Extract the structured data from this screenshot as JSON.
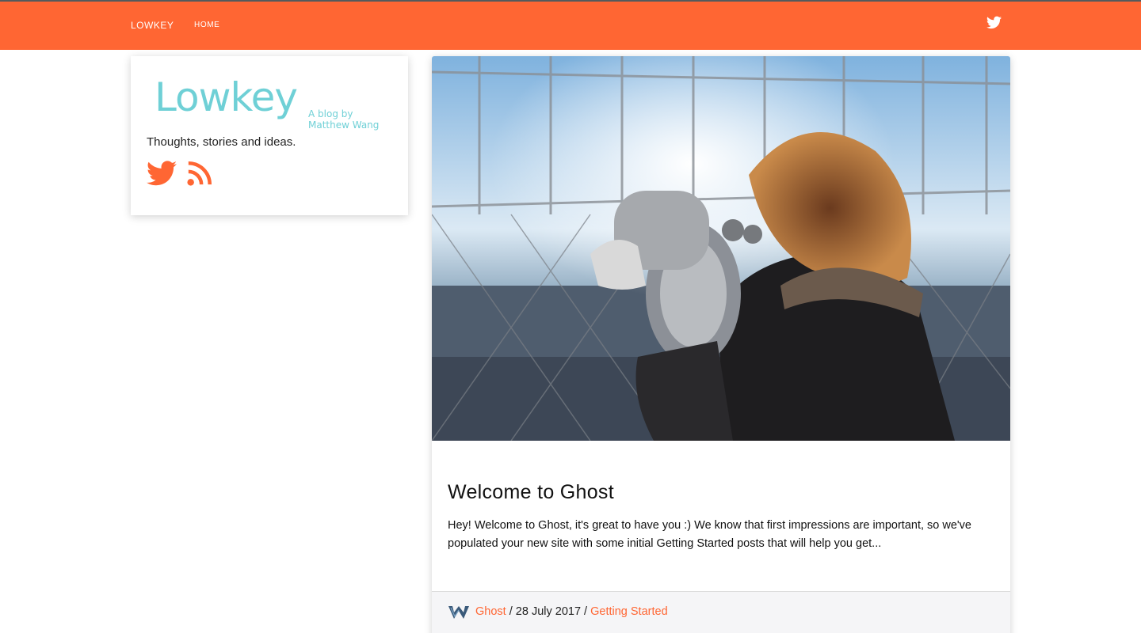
{
  "navbar": {
    "brand": "LOWKEY",
    "links": [
      {
        "label": "HOME"
      }
    ],
    "twitter_icon": "twitter-icon",
    "background": "#ff6633"
  },
  "sidebar": {
    "logo_word": "Lowkey",
    "logo_sub": "A blog by Matthew Wang",
    "tagline": "Thoughts, stories and ideas.",
    "social_icons": [
      "twitter-icon",
      "rss-icon"
    ],
    "icon_color": "#ff6633",
    "logo_color": "#6fd0d6"
  },
  "post": {
    "title": "Welcome to Ghost",
    "excerpt": "Hey! Welcome to Ghost, it's great to have you :) We know that first impressions are important, so we've populated your new site with some initial Getting Started posts that will help you get...",
    "author": "Ghost",
    "separator": "/",
    "date": "28 July 2017",
    "tag": "Getting Started"
  }
}
